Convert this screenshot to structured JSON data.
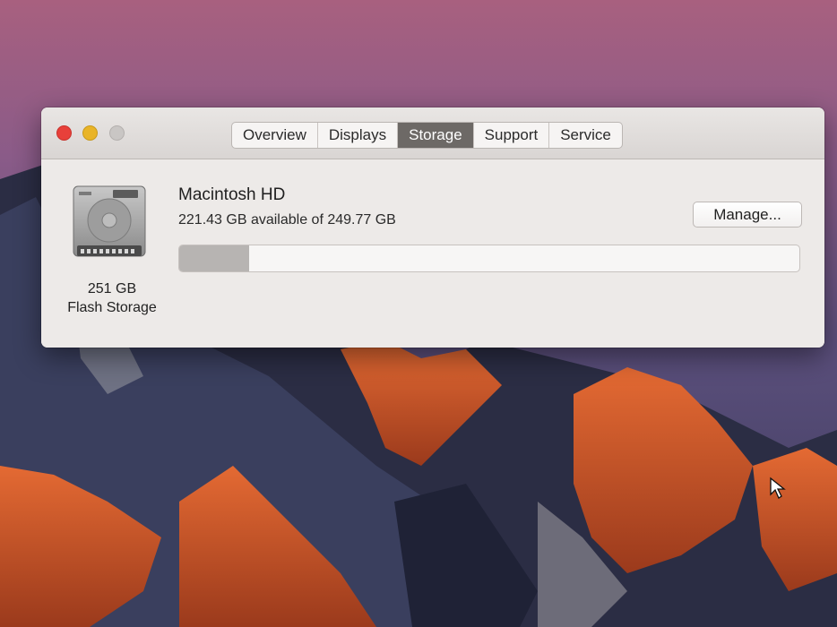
{
  "window": {
    "tabs": [
      {
        "label": "Overview",
        "active": false
      },
      {
        "label": "Displays",
        "active": false
      },
      {
        "label": "Storage",
        "active": true
      },
      {
        "label": "Support",
        "active": false
      },
      {
        "label": "Service",
        "active": false
      }
    ]
  },
  "storage": {
    "disk_icon": "hard-drive-icon",
    "capacity": "251 GB",
    "type": "Flash Storage",
    "volume_name": "Macintosh HD",
    "availability": "221.43 GB available of 249.77 GB",
    "manage_label": "Manage...",
    "used_fraction": 0.113
  },
  "colors": {
    "close": "#e8403a",
    "minimize": "#e9b427",
    "active_tab": "#6d6966",
    "usage_fill": "#b7b4b2"
  }
}
